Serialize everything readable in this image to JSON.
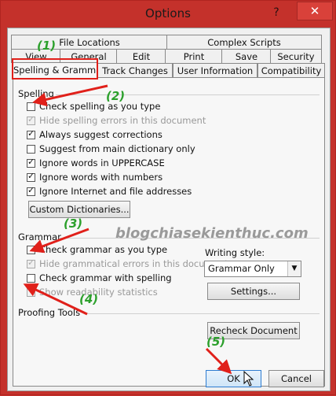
{
  "window": {
    "title": "Options",
    "help_glyph": "?",
    "close_glyph": "✕"
  },
  "tabs": {
    "back": [
      "File Locations",
      "Complex Scripts"
    ],
    "middle": [
      "View",
      "General",
      "Edit",
      "Print",
      "Save",
      "Security"
    ],
    "front": [
      "Spelling & Grammar",
      "Track Changes",
      "User Information",
      "Compatibility"
    ],
    "active": "Spelling & Grammar"
  },
  "spelling": {
    "heading": "Spelling",
    "options": [
      {
        "label": "Check spelling as you type",
        "checked": false,
        "enabled": true
      },
      {
        "label": "Hide spelling errors in this document",
        "checked": true,
        "enabled": false
      },
      {
        "label": "Always suggest corrections",
        "checked": true,
        "enabled": true
      },
      {
        "label": "Suggest from main dictionary only",
        "checked": false,
        "enabled": true
      },
      {
        "label": "Ignore words in UPPERCASE",
        "checked": true,
        "enabled": true
      },
      {
        "label": "Ignore words with numbers",
        "checked": true,
        "enabled": true
      },
      {
        "label": "Ignore Internet and file addresses",
        "checked": true,
        "enabled": true
      }
    ],
    "custom_dictionaries_label": "Custom Dictionaries..."
  },
  "grammar": {
    "heading": "Grammar",
    "options": [
      {
        "label": "Check grammar as you type",
        "checked": false,
        "enabled": true
      },
      {
        "label": "Hide grammatical errors in this document",
        "checked": true,
        "enabled": false
      },
      {
        "label": "Check grammar with spelling",
        "checked": false,
        "enabled": true
      },
      {
        "label": "Show readability statistics",
        "checked": false,
        "enabled": false
      }
    ],
    "writing_style_label": "Writing style:",
    "writing_style_value": "Grammar Only",
    "settings_label": "Settings..."
  },
  "proofing": {
    "heading": "Proofing Tools",
    "recheck_label": "Recheck Document"
  },
  "footer": {
    "ok_label": "OK",
    "cancel_label": "Cancel"
  },
  "watermark": "blogchiasekienthuc.com",
  "annotations": {
    "steps": [
      "(1)",
      "(2)",
      "(3)",
      "(4)",
      "(5)"
    ],
    "arrow_color": "#e0201a",
    "label_color": "#2ca02c"
  }
}
